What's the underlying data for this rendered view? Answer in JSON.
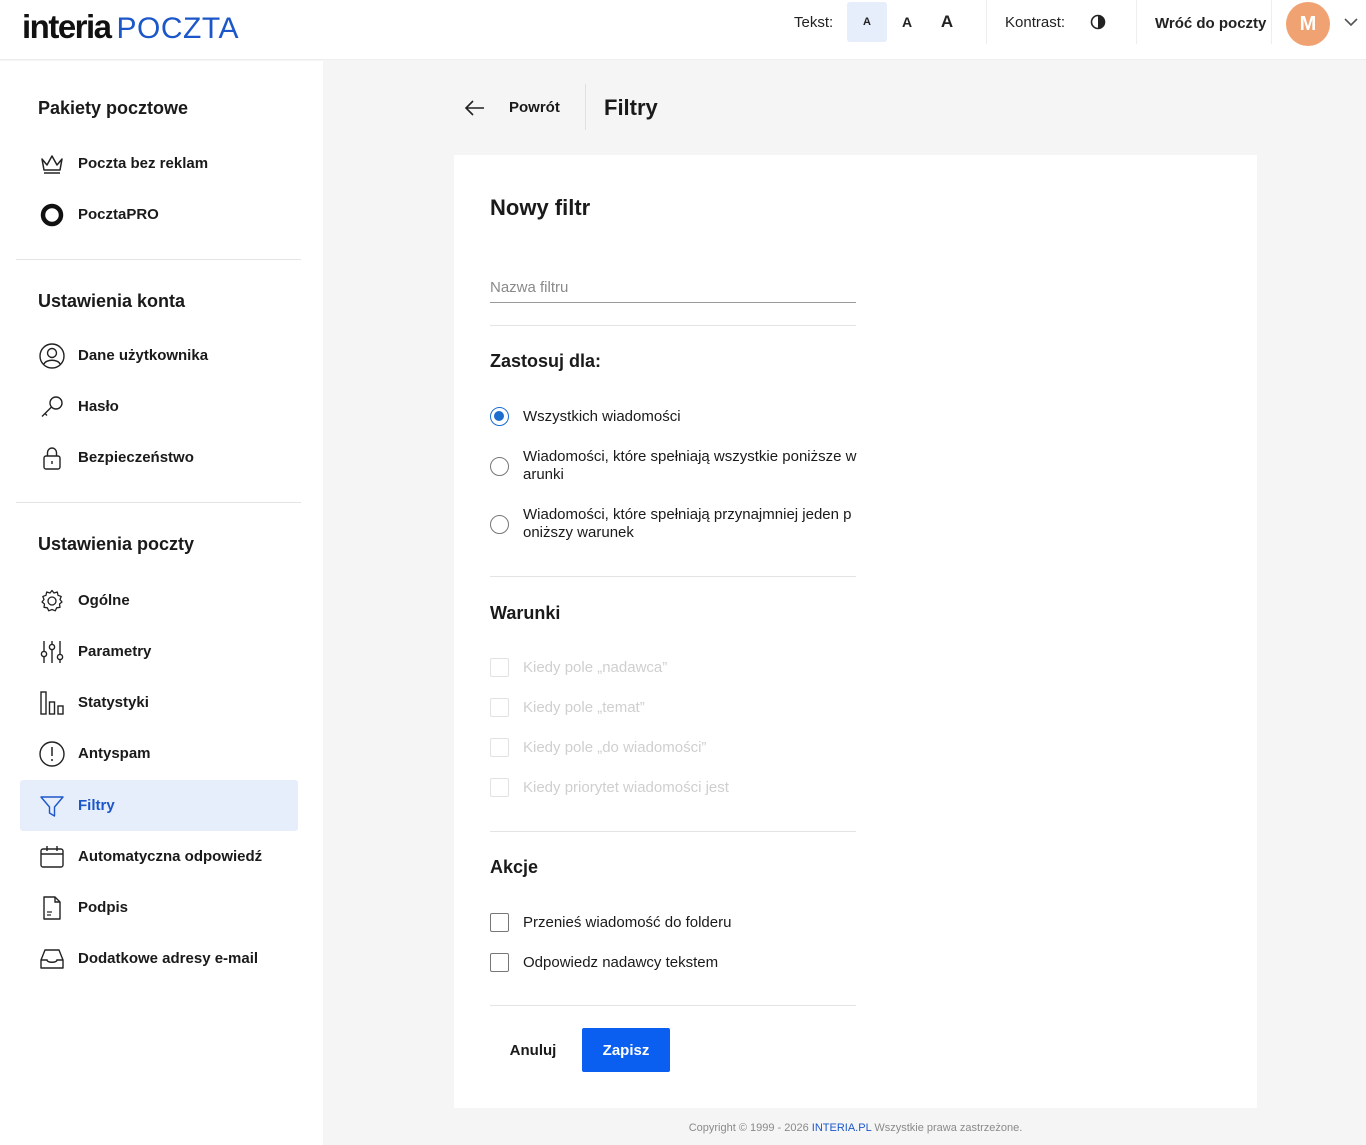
{
  "header": {
    "brand": "interia",
    "product": "POCZTA",
    "text_size_label": "Tekst:",
    "text_sizes": [
      "A",
      "A",
      "A"
    ],
    "active_text_size": 0,
    "contrast_label": "Kontrast:",
    "back_to_mail": "Wróć do poczty",
    "avatar_initial": "M",
    "avatar_color": "#f0a272"
  },
  "sidebar": {
    "sections": [
      {
        "title": "Pakiety pocztowe",
        "items": [
          {
            "label": "Poczta bez reklam",
            "icon": "crown-icon"
          },
          {
            "label": "PocztaPRO",
            "icon": "pro-ring-icon"
          }
        ]
      },
      {
        "title": "Ustawienia konta",
        "items": [
          {
            "label": "Dane użytkownika",
            "icon": "user-icon"
          },
          {
            "label": "Hasło",
            "icon": "key-icon"
          },
          {
            "label": "Bezpieczeństwo",
            "icon": "lock-icon"
          }
        ]
      },
      {
        "title": "Ustawienia poczty",
        "items": [
          {
            "label": "Ogólne",
            "icon": "gear-icon"
          },
          {
            "label": "Parametry",
            "icon": "sliders-icon"
          },
          {
            "label": "Statystyki",
            "icon": "bar-chart-icon"
          },
          {
            "label": "Antyspam",
            "icon": "alert-circle-icon"
          },
          {
            "label": "Filtry",
            "icon": "filter-icon",
            "active": true
          },
          {
            "label": "Automatyczna odpowiedź",
            "icon": "calendar-icon"
          },
          {
            "label": "Podpis",
            "icon": "document-icon"
          },
          {
            "label": "Dodatkowe adresy e-mail",
            "icon": "inbox-icon"
          }
        ]
      }
    ]
  },
  "main": {
    "back_label": "Powrót",
    "page_title": "Filtry",
    "form": {
      "title": "Nowy filtr",
      "name_placeholder": "Nazwa filtru",
      "name_value": "",
      "apply_title": "Zastosuj dla:",
      "apply_options": [
        {
          "label": "Wszystkich wiadomości",
          "checked": true
        },
        {
          "label": "Wiadomości, które spełniają wszystkie poniższe warunki",
          "checked": false
        },
        {
          "label": "Wiadomości, które spełniają przynajmniej jeden poniższy warunek",
          "checked": false
        }
      ],
      "conditions_title": "Warunki",
      "conditions": [
        "Kiedy pole „nadawca”",
        "Kiedy pole „temat”",
        "Kiedy pole „do wiadomości”",
        "Kiedy priorytet wiadomości jest"
      ],
      "actions_title": "Akcje",
      "actions": [
        "Przenieś wiadomość do folderu",
        "Odpowiedz nadawcy tekstem"
      ],
      "cancel_label": "Anuluj",
      "save_label": "Zapisz",
      "accent_color": "#0a5ef0"
    }
  },
  "footer": {
    "prefix": "Copyright © 1999 - 2026",
    "link": "INTERIA.PL",
    "suffix": "Wszystkie prawa zastrzeżone."
  }
}
